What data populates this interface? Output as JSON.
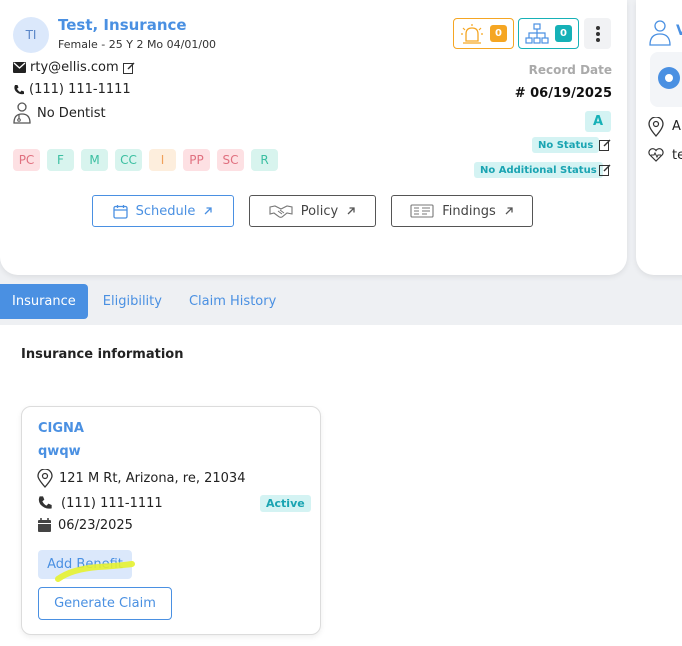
{
  "patient": {
    "initials": "TI",
    "name": "Test, Insurance",
    "demographics": "Female - 25 Y 2 Mo 04/01/00",
    "email": "rty@ellis.com",
    "phone": "(111) 111-1111",
    "dentist": "No Dentist"
  },
  "counters": {
    "alerts": "0",
    "family": "0"
  },
  "record_date": {
    "label": "Record Date",
    "value": "# 06/19/2025"
  },
  "status": {
    "grade": "A",
    "status": "No Status",
    "additional": "No Additional Status"
  },
  "tags": [
    {
      "label": "PC",
      "bg": "#fde0e3",
      "fg": "#e0707f"
    },
    {
      "label": "F",
      "bg": "#d8f4ee",
      "fg": "#3bbfa1"
    },
    {
      "label": "M",
      "bg": "#d8f4ee",
      "fg": "#3bbfa1"
    },
    {
      "label": "CC",
      "bg": "#d8f4ee",
      "fg": "#3bbfa1"
    },
    {
      "label": "I",
      "bg": "#fdeedd",
      "fg": "#f0a15a"
    },
    {
      "label": "PP",
      "bg": "#fde0e3",
      "fg": "#e0707f"
    },
    {
      "label": "SC",
      "bg": "#fde0e3",
      "fg": "#e0707f"
    },
    {
      "label": "R",
      "bg": "#d8f4ee",
      "fg": "#3bbfa1"
    }
  ],
  "actions": {
    "schedule": "Schedule",
    "policy": "Policy",
    "findings": "Findings"
  },
  "side_card": {
    "title_fragment": "V",
    "line1": "Al",
    "line2": "te"
  },
  "tabs": [
    "Insurance",
    "Eligibility",
    "Claim History"
  ],
  "section_title": "Insurance information",
  "insurance": {
    "carrier": "CIGNA",
    "plan": "qwqw",
    "address": "121 M Rt, Arizona, re, 21034",
    "phone": "(111) 111-1111",
    "status": "Active",
    "date": "06/23/2025",
    "add_benefit": "Add Benefit",
    "generate_claim": "Generate Claim"
  },
  "colors": {
    "accent": "#4a90e2",
    "alert_orange": "#f5a623",
    "teal": "#16b1b7",
    "highlight": "#e6f230"
  }
}
